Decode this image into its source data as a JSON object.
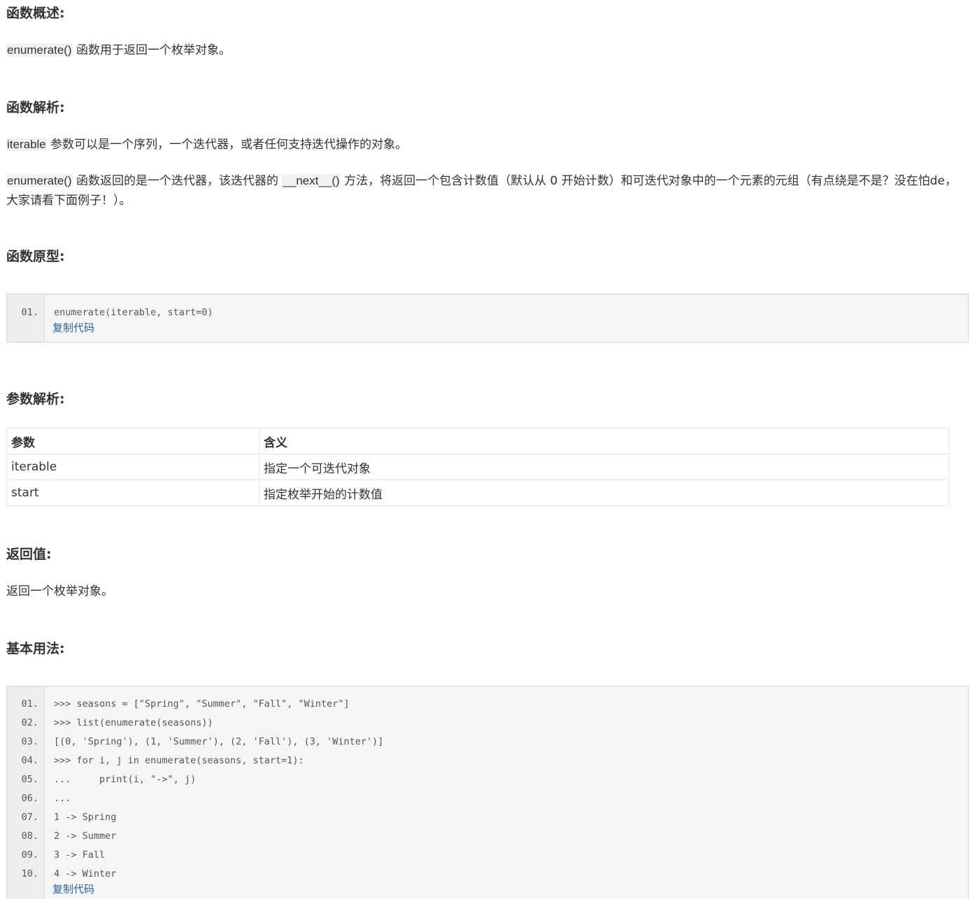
{
  "sections": {
    "overview": {
      "heading": "函数概述:",
      "code": "enumerate()",
      "text": " 函数用于返回一个枚举对象。"
    },
    "analysis": {
      "heading": "函数解析:",
      "p1_code": "iterable",
      "p1_text": " 参数可以是一个序列，一个迭代器，或者任何支持迭代操作的对象。",
      "p2_code1": "enumerate()",
      "p2_text1": " 函数返回的是一个迭代器，该迭代器的 ",
      "p2_code2": "__next__()",
      "p2_text2": " 方法，将返回一个包含计数值（默认从 0 开始计数）和可迭代对象中的一个元素的元组（有点绕是不是？没在怕de，大家请看下面例子！）。"
    },
    "prototype": {
      "heading": "函数原型:",
      "line_numbers": [
        "01."
      ],
      "lines": [
        "enumerate(iterable, start=0)"
      ],
      "copy_label": "复制代码"
    },
    "params": {
      "heading": "参数解析:",
      "headers": [
        "参数",
        "含义"
      ],
      "rows": [
        [
          "iterable",
          "指定一个可迭代对象"
        ],
        [
          "start",
          "指定枚举开始的计数值"
        ]
      ]
    },
    "returns": {
      "heading": "返回值:",
      "text": "返回一个枚举对象。"
    },
    "usage": {
      "heading": "基本用法:",
      "line_numbers": [
        "01.",
        "02.",
        "03.",
        "04.",
        "05.",
        "06.",
        "07.",
        "08.",
        "09.",
        "10."
      ],
      "lines": [
        ">>> seasons = [\"Spring\", \"Summer\", \"Fall\", \"Winter\"]",
        ">>> list(enumerate(seasons))",
        "[(0, 'Spring'), (1, 'Summer'), (2, 'Fall'), (3, 'Winter')]",
        ">>> for i, j in enumerate(seasons, start=1):",
        "...     print(i, \"->\", j)",
        "...",
        "1 -> Spring",
        "2 -> Summer",
        "3 -> Fall",
        "4 -> Winter"
      ],
      "copy_label": "复制代码"
    }
  }
}
